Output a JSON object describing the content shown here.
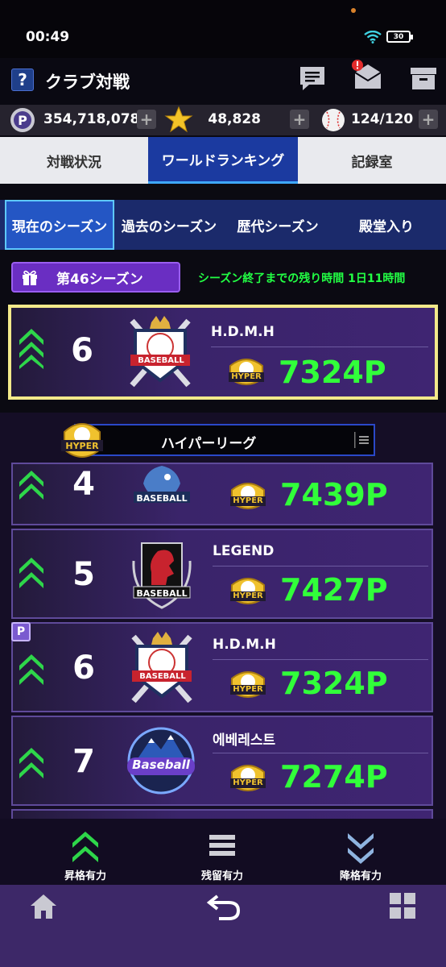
{
  "status": {
    "time": "00:49",
    "battery": "30"
  },
  "header": {
    "help": "?",
    "title": "クラブ対戦"
  },
  "currency": {
    "points": "354,718,078",
    "stars": "48,828",
    "balls": "124/120",
    "plus": "+"
  },
  "tabs": [
    {
      "label": "対戦状況"
    },
    {
      "label": "ワールドランキング"
    },
    {
      "label": "記録室"
    }
  ],
  "subtabs": [
    {
      "label": "現在のシーズン"
    },
    {
      "label": "過去のシーズン"
    },
    {
      "label": "歴代シーズン"
    },
    {
      "label": "殿堂入り"
    }
  ],
  "season": {
    "label": "第46シーズン",
    "time_left": "シーズン終了までの残り時間 1日11時間"
  },
  "my_entry": {
    "rank": "6",
    "team": "H.D.M.H",
    "points": "7324P",
    "league_badge": "HYPER"
  },
  "league": {
    "name": "ハイパーリーグ",
    "badge": "HYPER"
  },
  "rankings": [
    {
      "rank": "4",
      "team": "",
      "points": "7439P",
      "logo": "BASEBALL",
      "badge": "HYPER"
    },
    {
      "rank": "5",
      "team": "LEGEND",
      "points": "7427P",
      "logo": "BASEBALL",
      "badge": "HYPER"
    },
    {
      "rank": "6",
      "team": "H.D.M.H",
      "points": "7324P",
      "logo": "BASEBALL",
      "badge": "HYPER",
      "p_mark": "P"
    },
    {
      "rank": "7",
      "team": "에베레스트",
      "points": "7274P",
      "logo": "Baseball",
      "badge": "HYPER"
    }
  ],
  "legend": [
    {
      "label": "昇格有力"
    },
    {
      "label": "残留有力"
    },
    {
      "label": "降格有力"
    }
  ],
  "colors": {
    "accent_green": "#31ff3a",
    "tab_active": "#1b3aa0",
    "card_purple": "#3f2572"
  }
}
